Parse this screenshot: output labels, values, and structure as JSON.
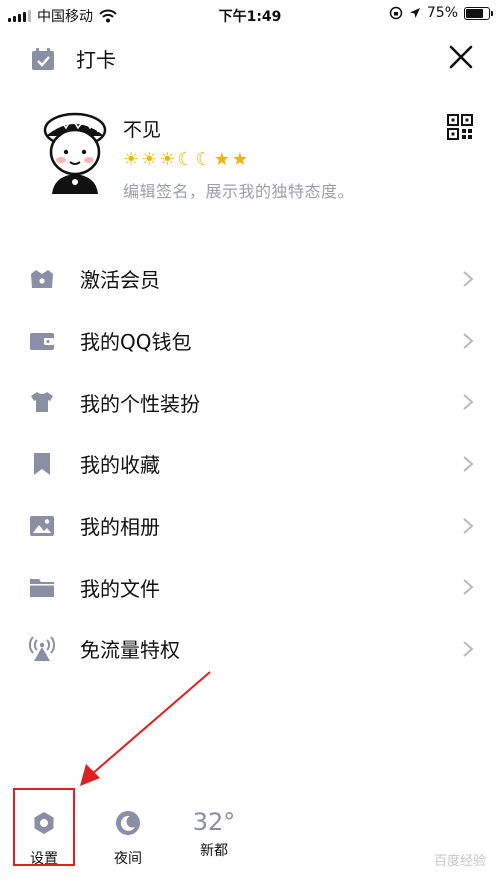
{
  "status_bar": {
    "carrier": "中国移动",
    "time": "下午1:49",
    "battery_percent": "75%",
    "battery_level": 0.75,
    "icons": [
      "signal-icon",
      "wifi-icon",
      "orientation-lock-icon",
      "location-icon",
      "battery-icon"
    ]
  },
  "header": {
    "checkin_label": "打卡",
    "checkin_icon": "calendar-check-icon",
    "close_icon": "close-icon"
  },
  "profile": {
    "nickname": "不见",
    "signature": "编辑签名，展示我的独特态度。",
    "level_icons": [
      "sun",
      "sun",
      "sun",
      "moon",
      "moon",
      "star",
      "star"
    ],
    "qr_icon": "qr-code-icon"
  },
  "menu": [
    {
      "label": "激活会员",
      "icon": "crown-icon"
    },
    {
      "label": "我的QQ钱包",
      "icon": "wallet-icon"
    },
    {
      "label": "我的个性装扮",
      "icon": "shirt-icon"
    },
    {
      "label": "我的收藏",
      "icon": "bookmark-icon"
    },
    {
      "label": "我的相册",
      "icon": "photo-icon"
    },
    {
      "label": "我的文件",
      "icon": "folder-icon"
    },
    {
      "label": "免流量特权",
      "icon": "signal-tower-icon"
    }
  ],
  "bottom": {
    "settings_label": "设置",
    "night_label": "夜间",
    "weather_temp": "32°",
    "weather_city": "新都"
  },
  "watermark": "百度经验",
  "colors": {
    "icon_gray": "#8a8fa6",
    "highlight_red": "#e02020",
    "level_gold": "#f5b400",
    "signature_gray": "#9aa0a6"
  }
}
